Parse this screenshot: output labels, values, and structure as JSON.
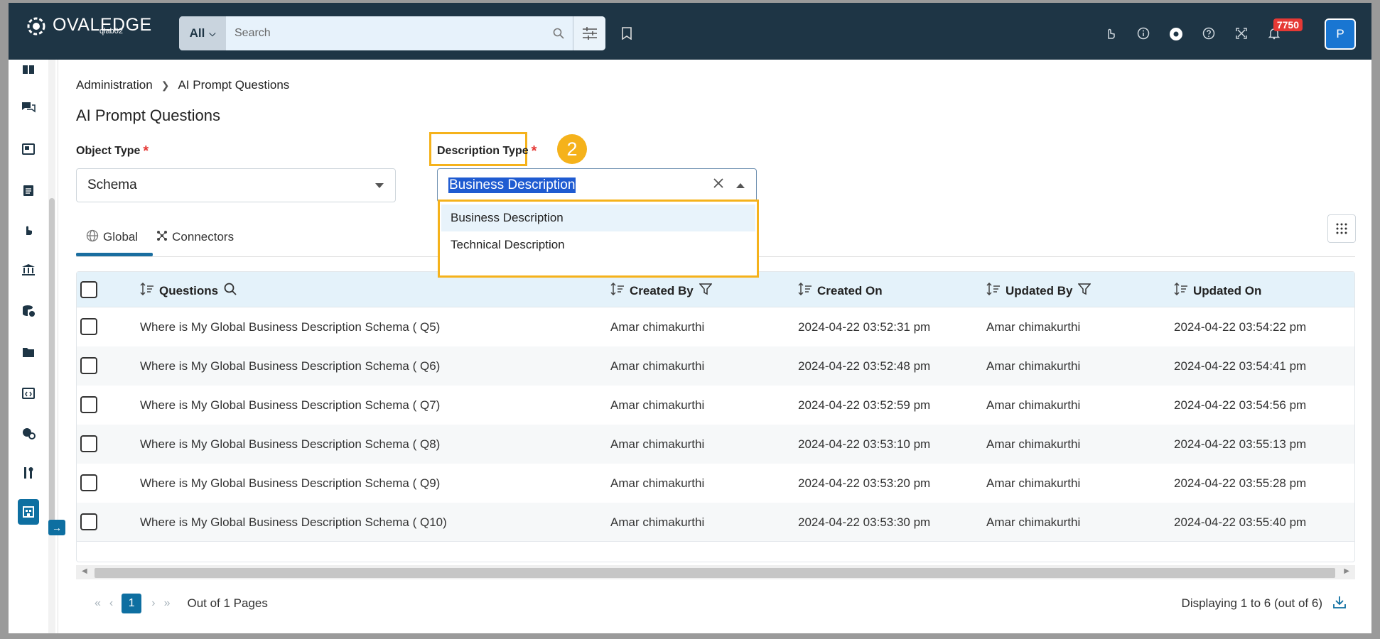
{
  "header": {
    "brand": "OVALEDGE",
    "environment": "qlab02",
    "search_scope": "All",
    "search_placeholder": "Search",
    "notification_count": "7750",
    "avatar_initial": "P"
  },
  "breadcrumb": {
    "parent": "Administration",
    "current": "AI Prompt Questions"
  },
  "page_title": "AI Prompt Questions",
  "form": {
    "object_type_label": "Object Type",
    "object_type_value": "Schema",
    "description_type_label": "Description Type",
    "description_type_value": "Business Description",
    "step_number": "2",
    "required_mark": "*",
    "description_options": [
      "Business Description",
      "Technical Description"
    ]
  },
  "tabs": [
    {
      "label": "Global"
    },
    {
      "label": "Connectors"
    }
  ],
  "table": {
    "columns": [
      "Questions",
      "Created By",
      "Created On",
      "Updated By",
      "Updated On"
    ],
    "rows": [
      {
        "question": "Where is My Global Business Description Schema ( Q5)",
        "created_by": "Amar chimakurthi",
        "created_on": "2024-04-22 03:52:31 pm",
        "updated_by": "Amar chimakurthi",
        "updated_on": "2024-04-22 03:54:22 pm"
      },
      {
        "question": "Where is My Global Business Description Schema ( Q6)",
        "created_by": "Amar chimakurthi",
        "created_on": "2024-04-22 03:52:48 pm",
        "updated_by": "Amar chimakurthi",
        "updated_on": "2024-04-22 03:54:41 pm"
      },
      {
        "question": "Where is My Global Business Description Schema ( Q7)",
        "created_by": "Amar chimakurthi",
        "created_on": "2024-04-22 03:52:59 pm",
        "updated_by": "Amar chimakurthi",
        "updated_on": "2024-04-22 03:54:56 pm"
      },
      {
        "question": "Where is My Global Business Description Schema ( Q8)",
        "created_by": "Amar chimakurthi",
        "created_on": "2024-04-22 03:53:10 pm",
        "updated_by": "Amar chimakurthi",
        "updated_on": "2024-04-22 03:55:13 pm"
      },
      {
        "question": "Where is My Global Business Description Schema ( Q9)",
        "created_by": "Amar chimakurthi",
        "created_on": "2024-04-22 03:53:20 pm",
        "updated_by": "Amar chimakurthi",
        "updated_on": "2024-04-22 03:55:28 pm"
      },
      {
        "question": "Where is My Global Business Description Schema ( Q10)",
        "created_by": "Amar chimakurthi",
        "created_on": "2024-04-22 03:53:30 pm",
        "updated_by": "Amar chimakurthi",
        "updated_on": "2024-04-22 03:55:40 pm"
      }
    ]
  },
  "pagination": {
    "current_page": "1",
    "pages_text": "Out of 1 Pages",
    "display_text": "Displaying 1 to 6 (out of 6)"
  },
  "colors": {
    "header_bg": "#1e3545",
    "accent": "#0e6fa1",
    "highlight": "#f5b21b",
    "required": "#e53935"
  }
}
